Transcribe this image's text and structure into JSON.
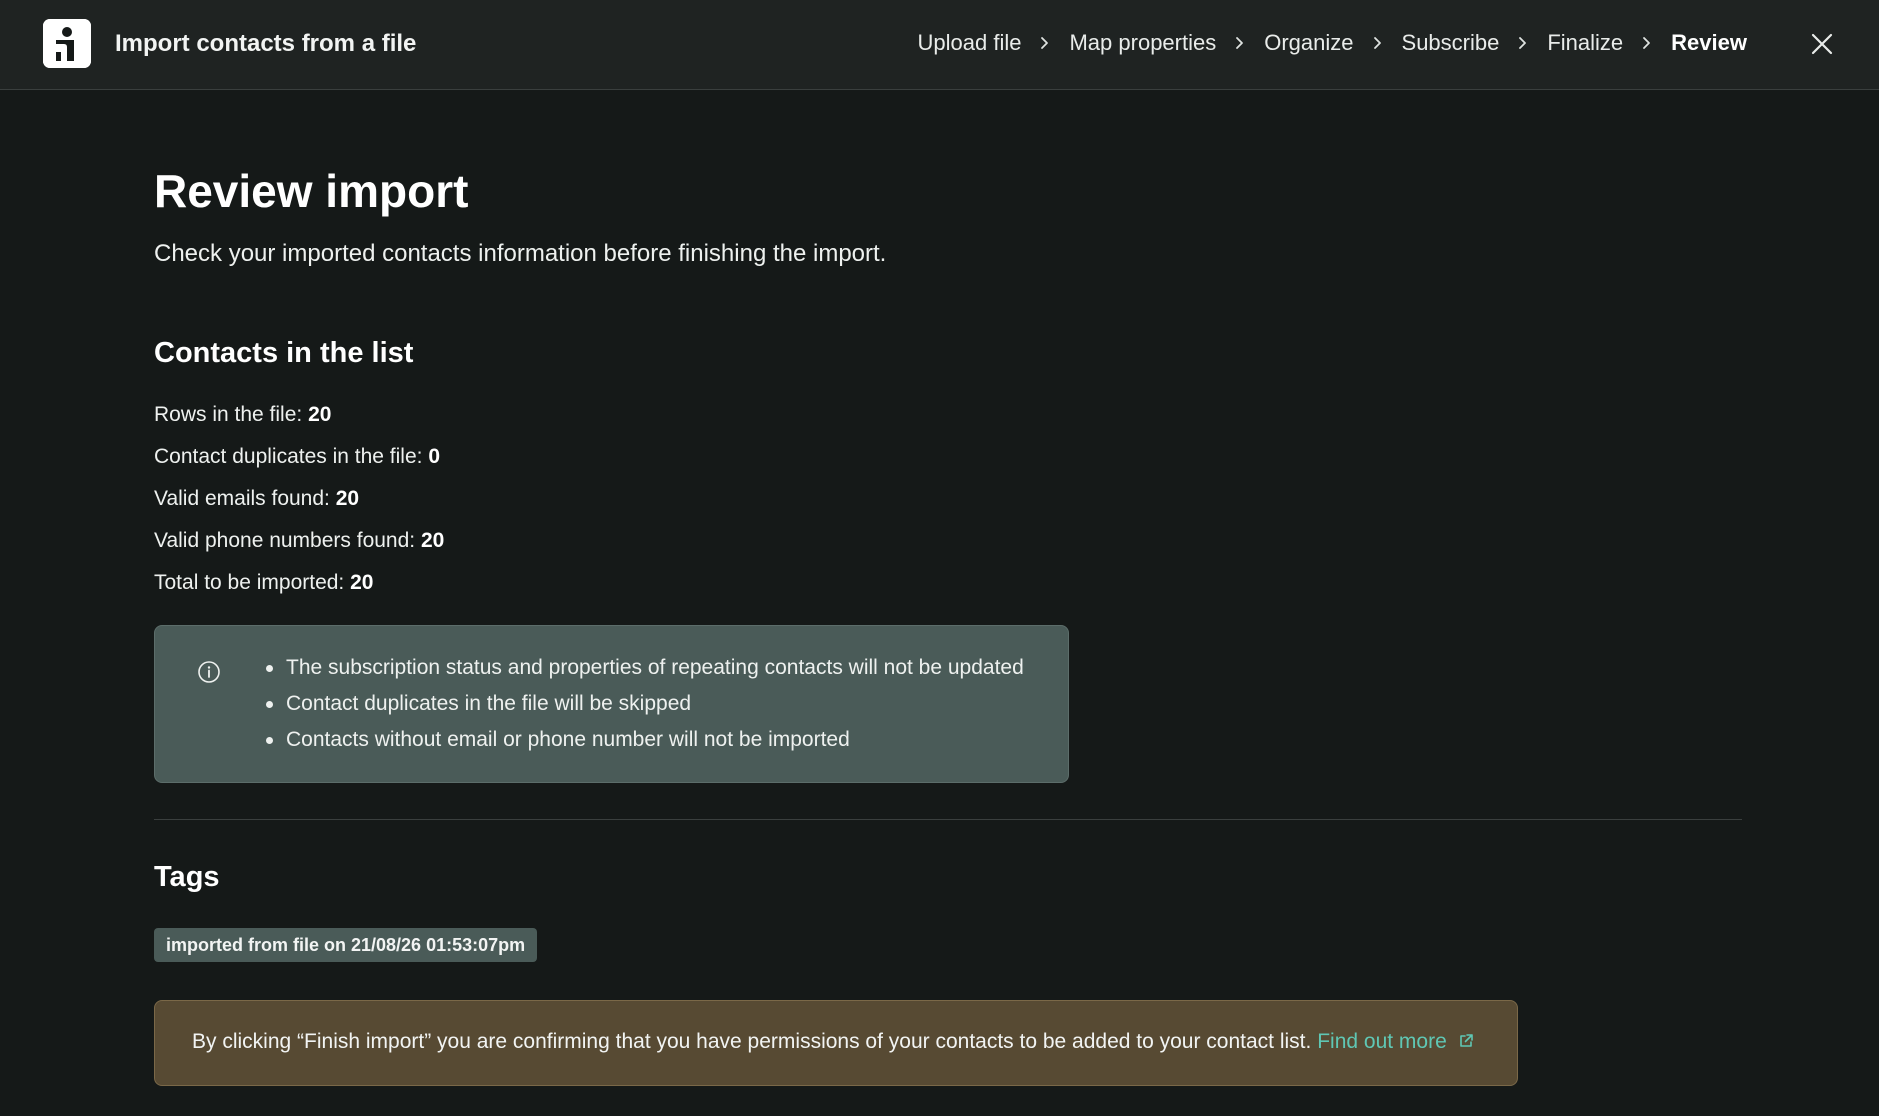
{
  "header": {
    "title": "Import contacts from a file",
    "steps": [
      {
        "label": "Upload file"
      },
      {
        "label": "Map properties"
      },
      {
        "label": "Organize"
      },
      {
        "label": "Subscribe"
      },
      {
        "label": "Finalize"
      },
      {
        "label": "Review"
      }
    ],
    "current_step": "Review"
  },
  "page": {
    "title": "Review import",
    "description": "Check your imported contacts information before finishing the import."
  },
  "contacts": {
    "title": "Contacts in the list",
    "stats": [
      {
        "label": "Rows in the file:",
        "value": "20"
      },
      {
        "label": "Contact duplicates in the file:",
        "value": "0"
      },
      {
        "label": "Valid emails found:",
        "value": "20"
      },
      {
        "label": "Valid phone numbers found:",
        "value": "20"
      },
      {
        "label": "Total to be imported:",
        "value": "20"
      }
    ],
    "notes": [
      "The subscription status and properties of repeating contacts will not be updated",
      "Contact duplicates in the file will be skipped",
      "Contacts without email or phone number will not be imported"
    ]
  },
  "tags": {
    "title": "Tags",
    "items": [
      "imported from file on 21/08/26 01:53:07pm"
    ]
  },
  "consent": {
    "text": "By clicking “Finish import” you are confirming that you have permissions of your contacts to be added to your contact list.",
    "link": "Find out more"
  },
  "colors": {
    "background": "#151918",
    "header": "#1f2322",
    "info_box": "#4a5b58",
    "warning_box": "#574a33",
    "link": "#5fc7b4"
  }
}
